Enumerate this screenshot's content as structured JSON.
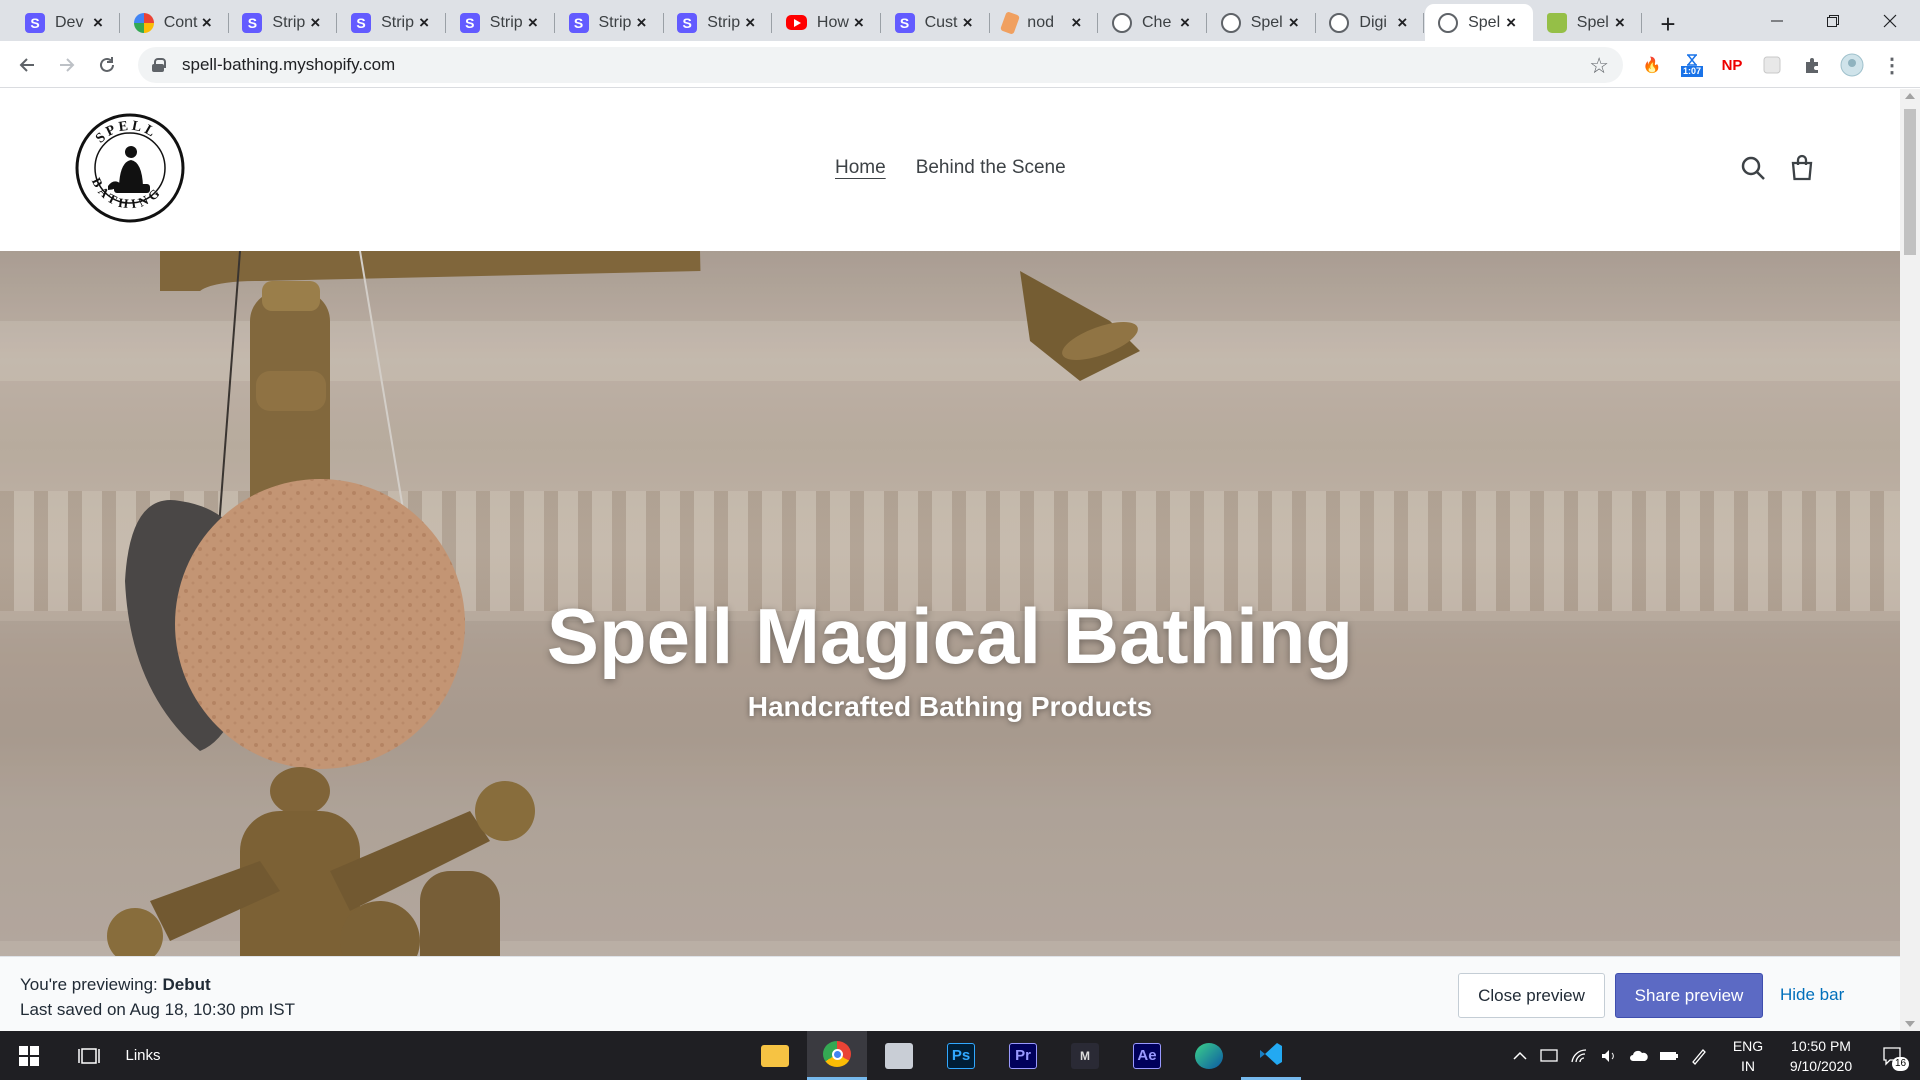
{
  "browser": {
    "tabs": [
      {
        "title": "Dev",
        "favicon": "stripe-icon"
      },
      {
        "title": "Cont",
        "favicon": "google-multicolor-icon"
      },
      {
        "title": "Strip",
        "favicon": "stripe-icon"
      },
      {
        "title": "Strip",
        "favicon": "stripe-icon"
      },
      {
        "title": "Strip",
        "favicon": "stripe-icon"
      },
      {
        "title": "Strip",
        "favicon": "stripe-icon"
      },
      {
        "title": "Strip",
        "favicon": "stripe-icon"
      },
      {
        "title": "How",
        "favicon": "youtube-icon"
      },
      {
        "title": "Cust",
        "favicon": "stripe-icon"
      },
      {
        "title": "nod",
        "favicon": "node-icon"
      },
      {
        "title": "Che",
        "favicon": "globe-icon"
      },
      {
        "title": "Spel",
        "favicon": "globe-icon"
      },
      {
        "title": "Digi",
        "favicon": "globe-icon"
      },
      {
        "title": "Spel",
        "favicon": "globe-icon",
        "active": true
      },
      {
        "title": "Spel",
        "favicon": "shopify-icon"
      }
    ],
    "url": "spell-bathing.myshopify.com",
    "extensions": {
      "timer_badge": "1:07",
      "np_label": "NP"
    }
  },
  "store": {
    "nav": [
      "Home",
      "Behind the Scene"
    ],
    "hero_title": "Spell Magical Bathing",
    "hero_subtitle": "Handcrafted Bathing Products"
  },
  "preview_bar": {
    "previewing_prefix": "You're previewing: ",
    "theme_name": "Debut",
    "last_saved": "Last saved on Aug 18, 10:30 pm IST",
    "close_label": "Close preview",
    "share_label": "Share preview",
    "hide_label": "Hide bar",
    "share_color": "#5c6ac4"
  },
  "taskbar": {
    "links_label": "Links",
    "lang_line1": "ENG",
    "lang_line2": "IN",
    "time": "10:50 PM",
    "date": "9/10/2020",
    "notification_count": "16"
  }
}
